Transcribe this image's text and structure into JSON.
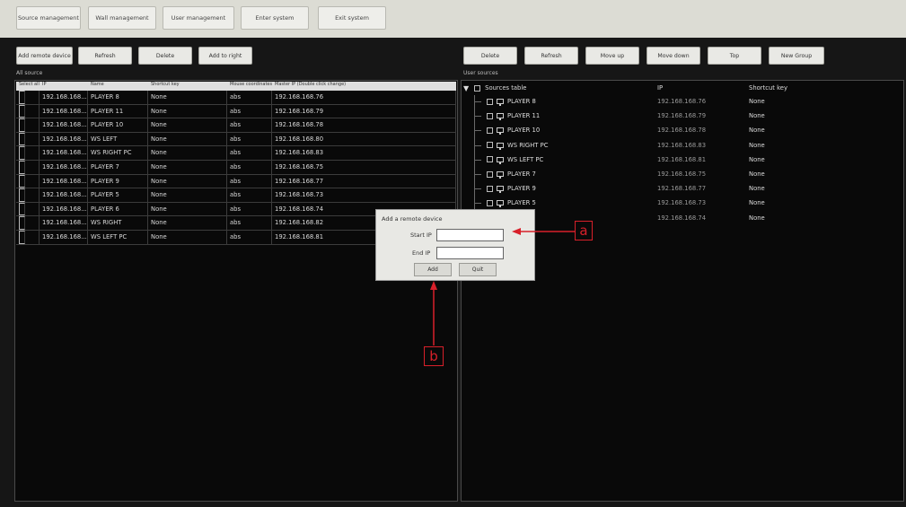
{
  "topnav": {
    "items": [
      "Source management",
      "Wall management",
      "User management",
      "Enter system",
      "Exit system"
    ]
  },
  "left": {
    "buttons": [
      "Add remote device",
      "Refresh",
      "Delete",
      "Add to right"
    ],
    "section": "All source",
    "columns": [
      "Select all",
      "IP",
      "Name",
      "Shortcut key",
      "Mouse coordinates",
      "Master IP (Double click change)"
    ],
    "rows": [
      {
        "ip": "192.168.168...",
        "name": "PLAYER 8",
        "key": "None",
        "mouse": "abs",
        "master": "192.168.168.76"
      },
      {
        "ip": "192.168.168...",
        "name": "PLAYER 11",
        "key": "None",
        "mouse": "abs",
        "master": "192.168.168.79"
      },
      {
        "ip": "192.168.168...",
        "name": "PLAYER 10",
        "key": "None",
        "mouse": "abs",
        "master": "192.168.168.78"
      },
      {
        "ip": "192.168.168...",
        "name": "WS LEFT",
        "key": "None",
        "mouse": "abs",
        "master": "192.168.168.80"
      },
      {
        "ip": "192.168.168...",
        "name": "WS RIGHT PC",
        "key": "None",
        "mouse": "abs",
        "master": "192.168.168.83"
      },
      {
        "ip": "192.168.168...",
        "name": "PLAYER 7",
        "key": "None",
        "mouse": "abs",
        "master": "192.168.168.75"
      },
      {
        "ip": "192.168.168...",
        "name": "PLAYER 9",
        "key": "None",
        "mouse": "abs",
        "master": "192.168.168.77"
      },
      {
        "ip": "192.168.168...",
        "name": "PLAYER 5",
        "key": "None",
        "mouse": "abs",
        "master": "192.168.168.73"
      },
      {
        "ip": "192.168.168...",
        "name": "PLAYER 6",
        "key": "None",
        "mouse": "abs",
        "master": "192.168.168.74"
      },
      {
        "ip": "192.168.168...",
        "name": "WS RIGHT",
        "key": "None",
        "mouse": "abs",
        "master": "192.168.168.82"
      },
      {
        "ip": "192.168.168...",
        "name": "WS LEFT PC",
        "key": "None",
        "mouse": "abs",
        "master": "192.168.168.81"
      }
    ]
  },
  "right": {
    "buttons": [
      "Delete",
      "Refresh",
      "Move up",
      "Move down",
      "Top",
      "New Group"
    ],
    "section": "User sources",
    "header": {
      "name": "Sources table",
      "ip": "IP",
      "key": "Shortcut key"
    },
    "items": [
      {
        "name": "PLAYER 8",
        "ip": "192.168.168.76",
        "key": "None"
      },
      {
        "name": "PLAYER 11",
        "ip": "192.168.168.79",
        "key": "None"
      },
      {
        "name": "PLAYER 10",
        "ip": "192.168.168.78",
        "key": "None"
      },
      {
        "name": "WS RIGHT PC",
        "ip": "192.168.168.83",
        "key": "None"
      },
      {
        "name": "WS LEFT PC",
        "ip": "192.168.168.81",
        "key": "None"
      },
      {
        "name": "PLAYER 7",
        "ip": "192.168.168.75",
        "key": "None"
      },
      {
        "name": "PLAYER 9",
        "ip": "192.168.168.77",
        "key": "None"
      },
      {
        "name": "PLAYER 5",
        "ip": "192.168.168.73",
        "key": "None"
      },
      {
        "name": "",
        "ip": "192.168.168.74",
        "key": "None"
      }
    ]
  },
  "dialog": {
    "title": "Add a remote device",
    "start_label": "Start IP",
    "end_label": "End IP",
    "start_value": "",
    "end_value": "",
    "add": "Add",
    "quit": "Quit"
  },
  "annotations": {
    "a": "a",
    "b": "b"
  },
  "colors": {
    "annotation": "#d8202a"
  }
}
